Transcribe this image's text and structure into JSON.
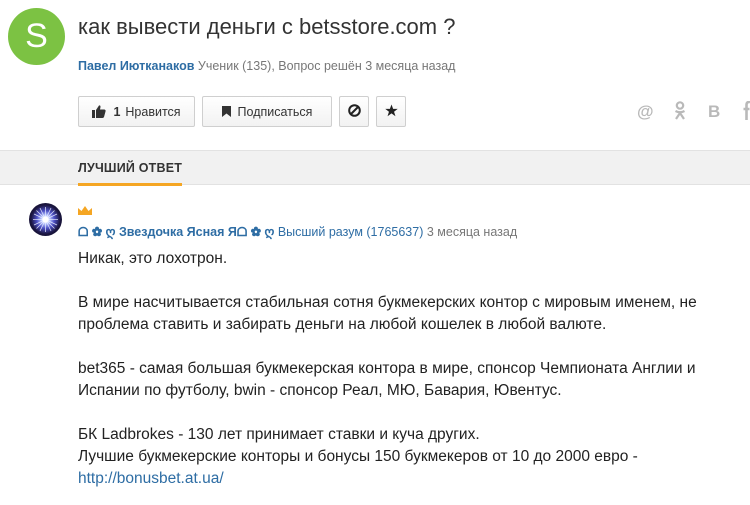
{
  "question": {
    "avatar_letter": "S",
    "title": "как вывести деньги с betsstore.com ?",
    "author": "Павел Иютканаков",
    "meta": "Ученик (135), Вопрос решён 3 месяца назад"
  },
  "toolbar": {
    "like_count": "1",
    "like_label": "Нравится",
    "subscribe_label": "Подписаться"
  },
  "share": [
    "@",
    "ok-icon",
    "В",
    "fb-icon"
  ],
  "tab": {
    "label": "ЛУЧШИЙ ОТВЕТ"
  },
  "answer": {
    "author": "ᗝ ✿ ღ Звездочка Ясная Яᗝ ✿ ღ",
    "rank": "Высший разум (1765637)",
    "time": "3 месяца назад",
    "paragraphs": [
      "Никак, это лохотрон.",
      "В мире насчитывается стабильная сотня букмекерских контор с мировым именем, не проблема ставить и забирать деньги на любой кошелек в любой валюте.",
      "bet365 - самая большая букмекерская контора в мире, спонсор Чемпионата Англии и Испании по футболу, bwin - спонсор Реал, МЮ, Бавария, Ювентус.",
      "БК Ladbrokes - 130 лет принимает ставки и куча других."
    ],
    "last_line": "Лучшие букмекерские конторы и бонусы 150 букмекеров от 10 до 2000 евро -",
    "link": "http://bonusbet.at.ua/"
  },
  "colors": {
    "avatar_green": "#7cc243",
    "link_blue": "#2e6da4",
    "tab_accent": "#f5a623",
    "crown": "#f5a623"
  }
}
